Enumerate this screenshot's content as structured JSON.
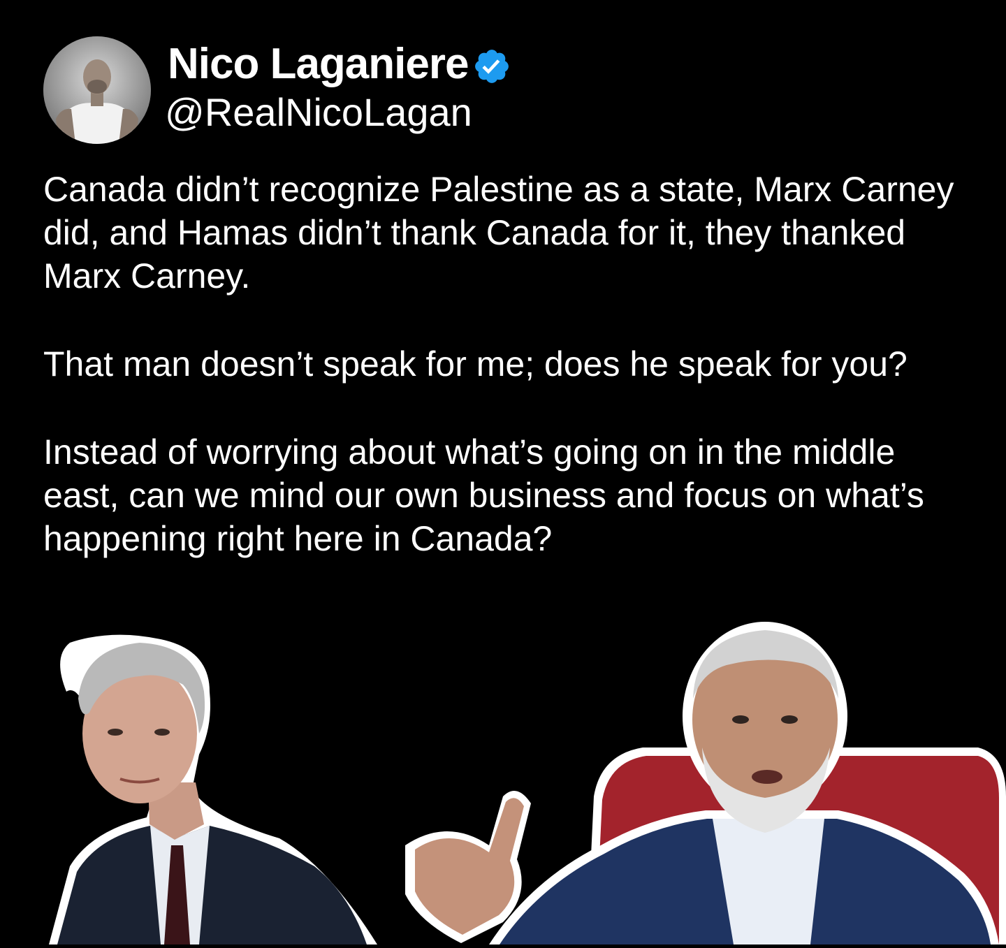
{
  "author": {
    "display_name": "Nico Laganiere",
    "handle": "@RealNicoLagan",
    "verified": true,
    "verified_color": "#1d9bf0",
    "avatar_icon": "profile-photo"
  },
  "post": {
    "paragraphs": [
      "Canada didn’t recognize Palestine as a state, Marx Carney did, and Hamas didn’t thank Canada for it, they thanked Marx Carney.",
      "That man doesn’t speak for me; does he speak for you?",
      "Instead of worrying about what’s going on in the middle east, can we mind our own business and focus on what’s happening right here in Canada?"
    ]
  },
  "colors": {
    "background": "#000000",
    "text": "#ffffff",
    "chair_red": "#a3232c"
  }
}
